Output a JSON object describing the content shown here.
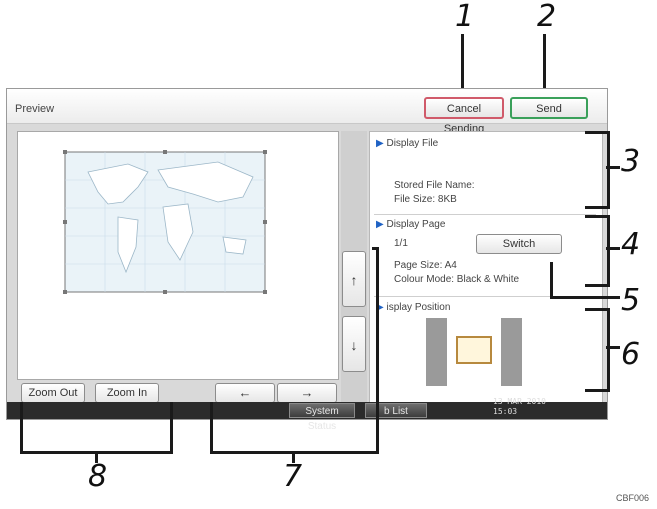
{
  "callouts": [
    "1",
    "2",
    "3",
    "4",
    "5",
    "6",
    "7",
    "8"
  ],
  "window": {
    "title": "Preview"
  },
  "header": {
    "cancel_label": "Cancel Sending",
    "send_label": "Send"
  },
  "display_file": {
    "heading": "Display File",
    "stored_name_label": "Stored File Name:",
    "file_size_label": "File Size: 8KB"
  },
  "display_page": {
    "heading": "Display Page",
    "page_count": "1/1",
    "switch_label": "Switch",
    "page_size_label": "Page Size: A4",
    "colour_mode_label": "Colour Mode: Black & White"
  },
  "display_position": {
    "heading": "isplay Position"
  },
  "nav": {
    "up": "↑",
    "down": "↓",
    "left": "←",
    "right": "→"
  },
  "zoom": {
    "out_label": "Zoom Out",
    "in_label": "Zoom In"
  },
  "status": {
    "system_status_label": "System Status",
    "job_list_label": "b List",
    "date": "13 MAR  2010",
    "time": "15:03"
  },
  "footer_code": "CBF006",
  "colors": {
    "cancel_border": "#d05a6a",
    "send_border": "#3aa05a",
    "arrow_blue": "#1f62c4"
  }
}
